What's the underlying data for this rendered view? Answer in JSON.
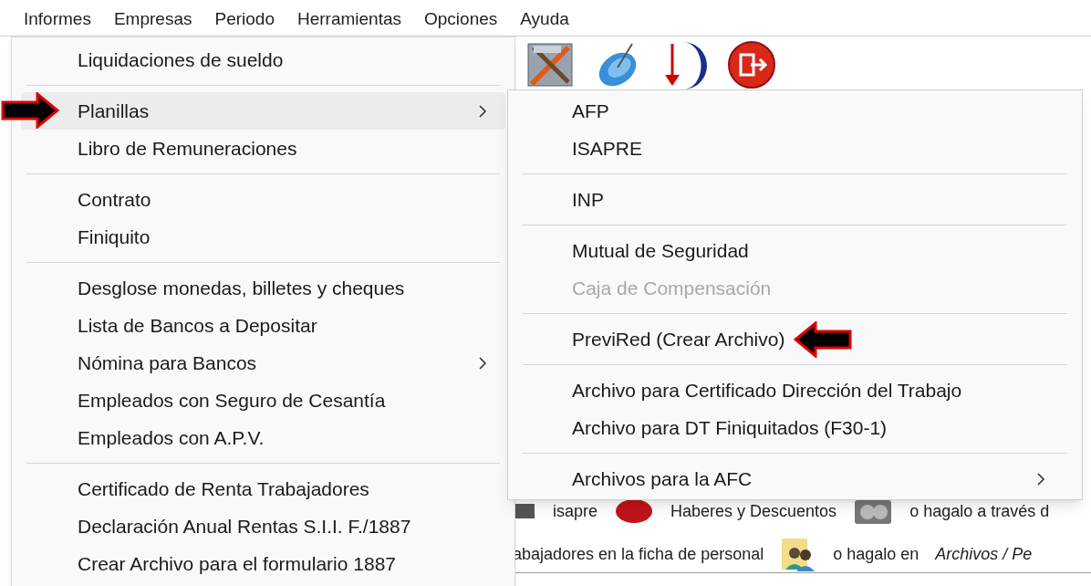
{
  "menu_bar": [
    "Informes",
    "Empresas",
    "Periodo",
    "Herramientas",
    "Opciones",
    "Ayuda"
  ],
  "main_menu": [
    [
      {
        "label": "Liquidaciones de sueldo",
        "submenu": false,
        "highlighted": false,
        "marked": false
      }
    ],
    [
      {
        "label": "Planillas",
        "submenu": true,
        "highlighted": true,
        "marked": true
      },
      {
        "label": "Libro de Remuneraciones",
        "submenu": false,
        "highlighted": false,
        "marked": false
      }
    ],
    [
      {
        "label": "Contrato",
        "submenu": false,
        "highlighted": false,
        "marked": false
      },
      {
        "label": "Finiquito",
        "submenu": false,
        "highlighted": false,
        "marked": false
      }
    ],
    [
      {
        "label": "Desglose monedas, billetes y cheques",
        "submenu": false,
        "highlighted": false,
        "marked": false
      },
      {
        "label": "Lista de Bancos a Depositar",
        "submenu": false,
        "highlighted": false,
        "marked": false
      },
      {
        "label": "Nómina para Bancos",
        "submenu": true,
        "highlighted": false,
        "marked": false
      },
      {
        "label": "Empleados con Seguro de Cesantía",
        "submenu": false,
        "highlighted": false,
        "marked": false
      },
      {
        "label": "Empleados con A.P.V.",
        "submenu": false,
        "highlighted": false,
        "marked": false
      }
    ],
    [
      {
        "label": "Certificado de Renta Trabajadores",
        "submenu": false,
        "highlighted": false,
        "marked": false
      },
      {
        "label": "Declaración Anual Rentas S.I.I. F./1887",
        "submenu": false,
        "highlighted": false,
        "marked": false
      },
      {
        "label": "Crear Archivo para el formulario 1887",
        "submenu": false,
        "highlighted": false,
        "marked": false
      }
    ]
  ],
  "submenu": [
    [
      {
        "label": "AFP",
        "submenu": false,
        "disabled": false,
        "marked": false
      },
      {
        "label": "ISAPRE",
        "submenu": false,
        "disabled": false,
        "marked": false
      }
    ],
    [
      {
        "label": "INP",
        "submenu": false,
        "disabled": false,
        "marked": false
      }
    ],
    [
      {
        "label": "Mutual de Seguridad",
        "submenu": false,
        "disabled": false,
        "marked": false
      },
      {
        "label": "Caja de Compensación",
        "submenu": false,
        "disabled": true,
        "marked": false
      }
    ],
    [
      {
        "label": "PreviRed (Crear Archivo)",
        "submenu": false,
        "disabled": false,
        "marked": true
      }
    ],
    [
      {
        "label": "Archivo para Certificado Dirección del Trabajo",
        "submenu": false,
        "disabled": false,
        "marked": false
      },
      {
        "label": "Archivo para DT Finiquitados (F30-1)",
        "submenu": false,
        "disabled": false,
        "marked": false
      }
    ],
    [
      {
        "label": "Archivos para la AFC",
        "submenu": true,
        "disabled": false,
        "marked": false
      }
    ]
  ],
  "background_text": {
    "row_1": [
      "isapre",
      "Haberes y Descuentos",
      "o hagalo a través d"
    ],
    "row_2": {
      "text": "abajadores en la ficha de personal",
      "middle": "o hagalo en",
      "path": "Archivos / Pe"
    }
  }
}
